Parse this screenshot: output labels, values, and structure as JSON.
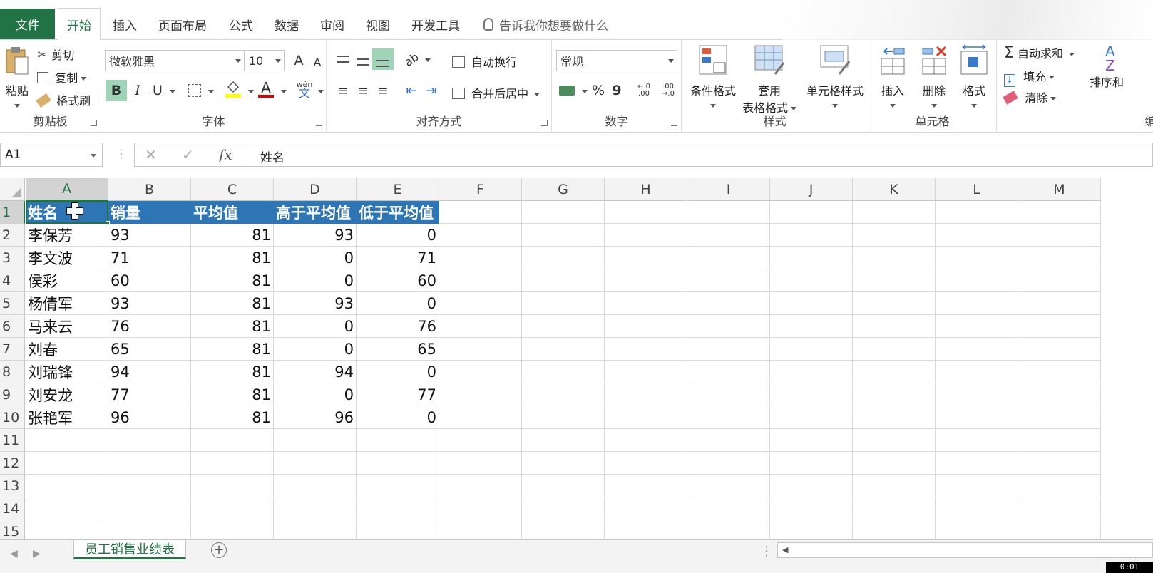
{
  "tabs": {
    "file": "文件",
    "items": [
      "开始",
      "插入",
      "页面布局",
      "公式",
      "数据",
      "审阅",
      "视图",
      "开发工具"
    ],
    "tell_me": "告诉我你想要做什么"
  },
  "ribbon": {
    "clipboard": {
      "paste": "粘贴",
      "cut": "剪切",
      "copy": "复制",
      "format_painter": "格式刷",
      "label": "剪贴板"
    },
    "font": {
      "name": "微软雅黑",
      "size": "10",
      "label": "字体",
      "bold": "B",
      "italic": "I",
      "underline": "U",
      "grow": "A",
      "shrink": "A",
      "phonetic": "文",
      "phonetic_top": "wén",
      "font_color": "A"
    },
    "alignment": {
      "wrap": "自动换行",
      "merge": "合并后居中",
      "label": "对齐方式"
    },
    "number": {
      "format": "常规",
      "percent": "%",
      "comma": "9",
      "inc_decimal": "←.0 .00",
      "dec_decimal": ".00 →.0",
      "label": "数字"
    },
    "styles": {
      "conditional": "条件格式",
      "table_line1": "套用",
      "table_line2": "表格格式",
      "cell_styles": "单元格样式",
      "label": "样式"
    },
    "cells": {
      "insert": "插入",
      "delete": "删除",
      "format": "格式",
      "label": "单元格"
    },
    "editing": {
      "autosum": "自动求和",
      "fill": "填充",
      "clear": "清除",
      "sort": "排序和",
      "label": "编辑",
      "sigma": "Σ"
    }
  },
  "formula_bar": {
    "name_box": "A1",
    "fx": "fx",
    "content": "姓名",
    "separator": "⋮",
    "cancel": "✕",
    "enter": "✓"
  },
  "grid": {
    "columns": [
      "A",
      "B",
      "C",
      "D",
      "E",
      "F",
      "G",
      "H",
      "I",
      "J",
      "K",
      "L",
      "M"
    ],
    "rows": [
      "1",
      "2",
      "3",
      "4",
      "5",
      "6",
      "7",
      "8",
      "9",
      "10",
      "11",
      "12",
      "13",
      "14",
      "15"
    ],
    "header": [
      "姓名",
      "销量",
      "平均值",
      "高于平均值",
      "低于平均值"
    ],
    "data": [
      [
        "李保芳",
        "93",
        "81",
        "93",
        "0"
      ],
      [
        "李文波",
        "71",
        "81",
        "0",
        "71"
      ],
      [
        "侯彩",
        "60",
        "81",
        "0",
        "60"
      ],
      [
        "杨倩军",
        "93",
        "81",
        "93",
        "0"
      ],
      [
        "马来云",
        "76",
        "81",
        "0",
        "76"
      ],
      [
        "刘春",
        "65",
        "81",
        "0",
        "65"
      ],
      [
        "刘瑞锋",
        "94",
        "81",
        "94",
        "0"
      ],
      [
        "刘安龙",
        "77",
        "81",
        "0",
        "77"
      ],
      [
        "张艳军",
        "96",
        "81",
        "96",
        "0"
      ]
    ]
  },
  "sheet_bar": {
    "sheet_name": "员工销售业绩表",
    "add": "+",
    "timer": "0:01",
    "nav_prev": "◀",
    "nav_next": "▶",
    "menu": "⋮",
    "scroll_left": "◀"
  }
}
